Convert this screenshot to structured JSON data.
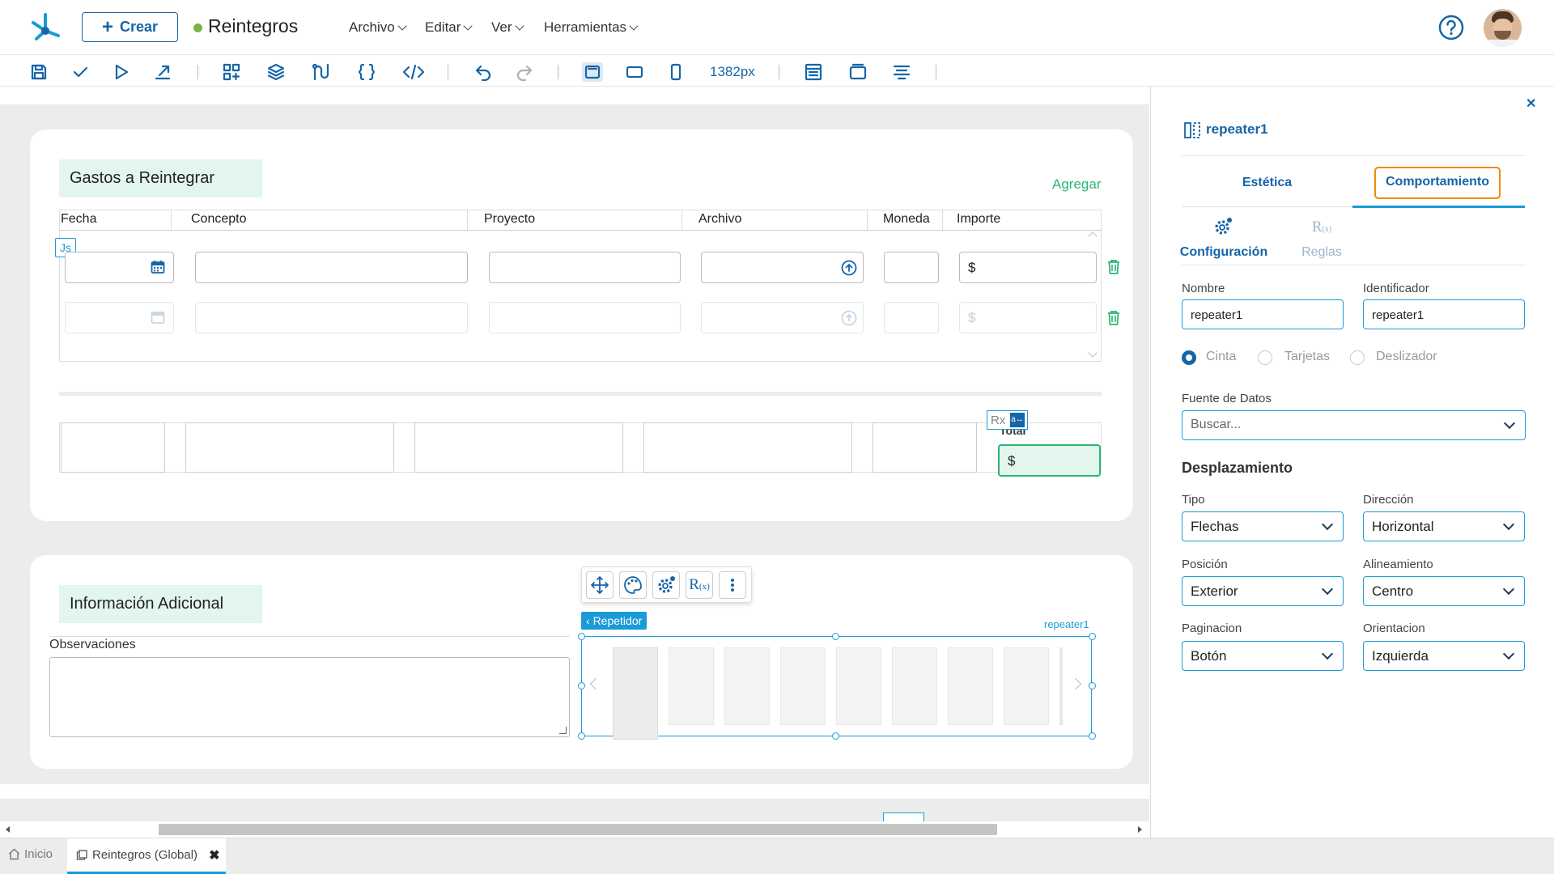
{
  "header": {
    "create_label": "Crear",
    "app_title": "Reintegros",
    "menus": [
      "Archivo",
      "Editar",
      "Ver",
      "Herramientas"
    ]
  },
  "toolbar": {
    "width_value": "1382px"
  },
  "gastos": {
    "title": "Gastos a Reintegrar",
    "add_label": "Agregar",
    "columns": [
      "Fecha",
      "Concepto",
      "Proyecto",
      "Archivo",
      "Moneda",
      "Importe"
    ],
    "currency_symbol": "$",
    "js_badge": "Js",
    "rx_badge": "Rx",
    "total_label": "Total",
    "total_prefix": "$"
  },
  "info": {
    "title": "Información Adicional",
    "observaciones_label": "Observaciones",
    "repeater_tag": "Repetidor",
    "repeater_name": "repeater1"
  },
  "panel": {
    "component_name": "repeater1",
    "tabs": [
      "Estética",
      "Comportamiento"
    ],
    "subtabs": [
      "Configuración",
      "Reglas"
    ],
    "nombre_label": "Nombre",
    "nombre_value": "repeater1",
    "identificador_label": "Identificador",
    "identificador_value": "repeater1",
    "radios": [
      "Cinta",
      "Tarjetas",
      "Deslizador"
    ],
    "fuente_label": "Fuente de Datos",
    "fuente_placeholder": "Buscar...",
    "desplazamiento_title": "Desplazamiento",
    "fields": [
      {
        "label": "Tipo",
        "value": "Flechas"
      },
      {
        "label": "Dirección",
        "value": "Horizontal"
      },
      {
        "label": "Posición",
        "value": "Exterior"
      },
      {
        "label": "Alineamiento",
        "value": "Centro"
      },
      {
        "label": "Paginacion",
        "value": "Botón"
      },
      {
        "label": "Orientacion",
        "value": "Izquierda"
      }
    ]
  },
  "bottom_tabs": [
    {
      "label": "Inicio"
    },
    {
      "label": "Reintegros (Global)"
    }
  ],
  "colors": {
    "brand_blue": "#1565a8",
    "accent_cyan": "#1a9bd7",
    "green": "#2bb673",
    "orange": "#f08a00",
    "canvas_gray": "#ececec"
  }
}
